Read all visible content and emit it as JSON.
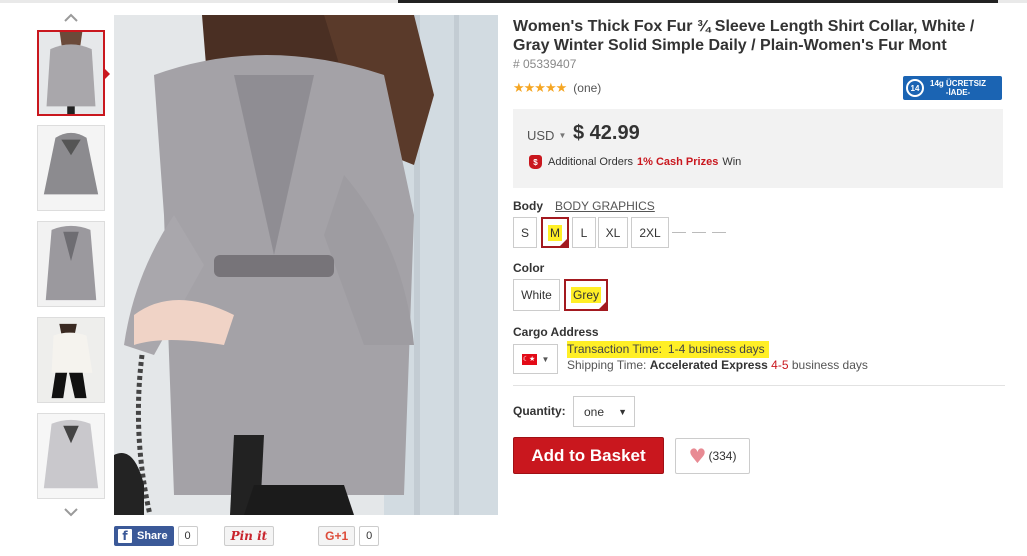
{
  "product": {
    "title": "Women's Thick Fox Fur ¾ Sleeve Length Shirt Collar, White / Gray Winter Solid Simple Daily / Plain-Women's Fur Mont",
    "sku": "# 05339407",
    "rating_stars": 5,
    "stars_text": "★★★★★",
    "review_count": "(one)",
    "return_badge": {
      "line1": "14g ÜCRETSIZ",
      "line2": "-İADE-",
      "icon": "14"
    }
  },
  "price": {
    "currency": "USD",
    "amount": "$ 42.99",
    "promo_prefix": "Additional Orders",
    "promo_highlight": "1% Cash Prizes",
    "promo_suffix": "Win",
    "promo_icon": "$"
  },
  "size": {
    "label": "Body",
    "chart_link": "BODY GRAPHICS",
    "options": [
      "S",
      "M",
      "L",
      "XL",
      "2XL"
    ],
    "selected": "M"
  },
  "color": {
    "label": "Color",
    "options": [
      "White",
      "Grey"
    ],
    "selected": "Grey"
  },
  "cargo": {
    "label": "Cargo Address",
    "flag_icon": "turkey-flag-icon",
    "flag_glyph": "☾★",
    "transaction_label": "Transaction Time:",
    "transaction_value": "1-4 business days",
    "shipping_label": "Shipping Time:",
    "shipping_method": "Accelerated Express",
    "shipping_days_num": "4-5",
    "shipping_days_unit": "business days"
  },
  "quantity": {
    "label": "Quantity:",
    "value": "one"
  },
  "actions": {
    "add_to_basket": "Add to Basket",
    "favorites_count": "(334)",
    "heart": "♥"
  },
  "social": {
    "facebook": "Share",
    "facebook_count": "0",
    "pinterest": "Pin it",
    "gplus": "G+1",
    "gplus_count": "0"
  },
  "colors": {
    "accent": "#c9171e",
    "highlight": "#ffef26",
    "badge": "#1b64b3"
  }
}
